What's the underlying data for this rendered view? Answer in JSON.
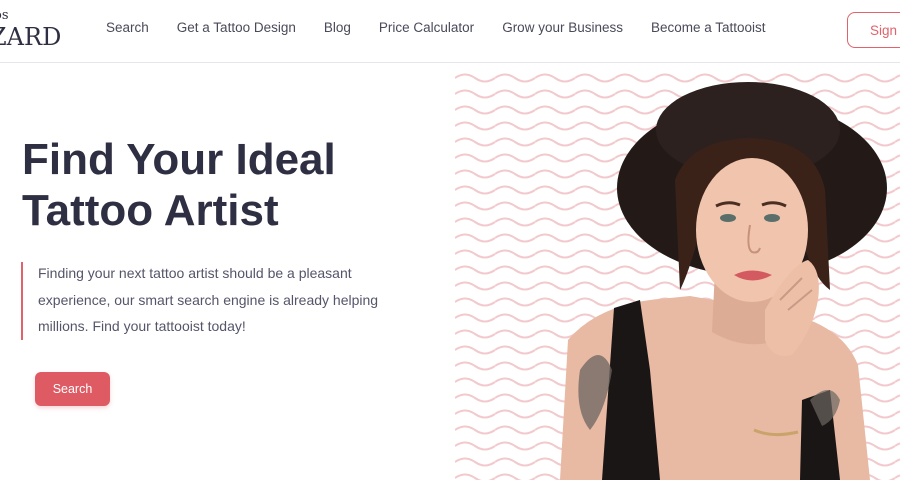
{
  "header": {
    "logo_top": "os",
    "logo_main": "ZARD",
    "nav": [
      {
        "label": "Search"
      },
      {
        "label": "Get a Tattoo Design"
      },
      {
        "label": "Blog"
      },
      {
        "label": "Price Calculator"
      },
      {
        "label": "Grow your Business"
      },
      {
        "label": "Become a Tattooist"
      }
    ],
    "signin_label": "Sign I"
  },
  "hero": {
    "title": "Find Your Ideal Tattoo Artist",
    "description": "Finding your next tattoo artist should be a pleasant experience, our smart search engine is already helping millions. Find your tattooist today!",
    "search_button": "Search"
  },
  "colors": {
    "accent": "#de5b63",
    "text_dark": "#2f2f44",
    "wave": "#f2c9cc",
    "hat": "#231a18"
  },
  "image": {
    "icon": "woman-with-black-hat-photo"
  }
}
